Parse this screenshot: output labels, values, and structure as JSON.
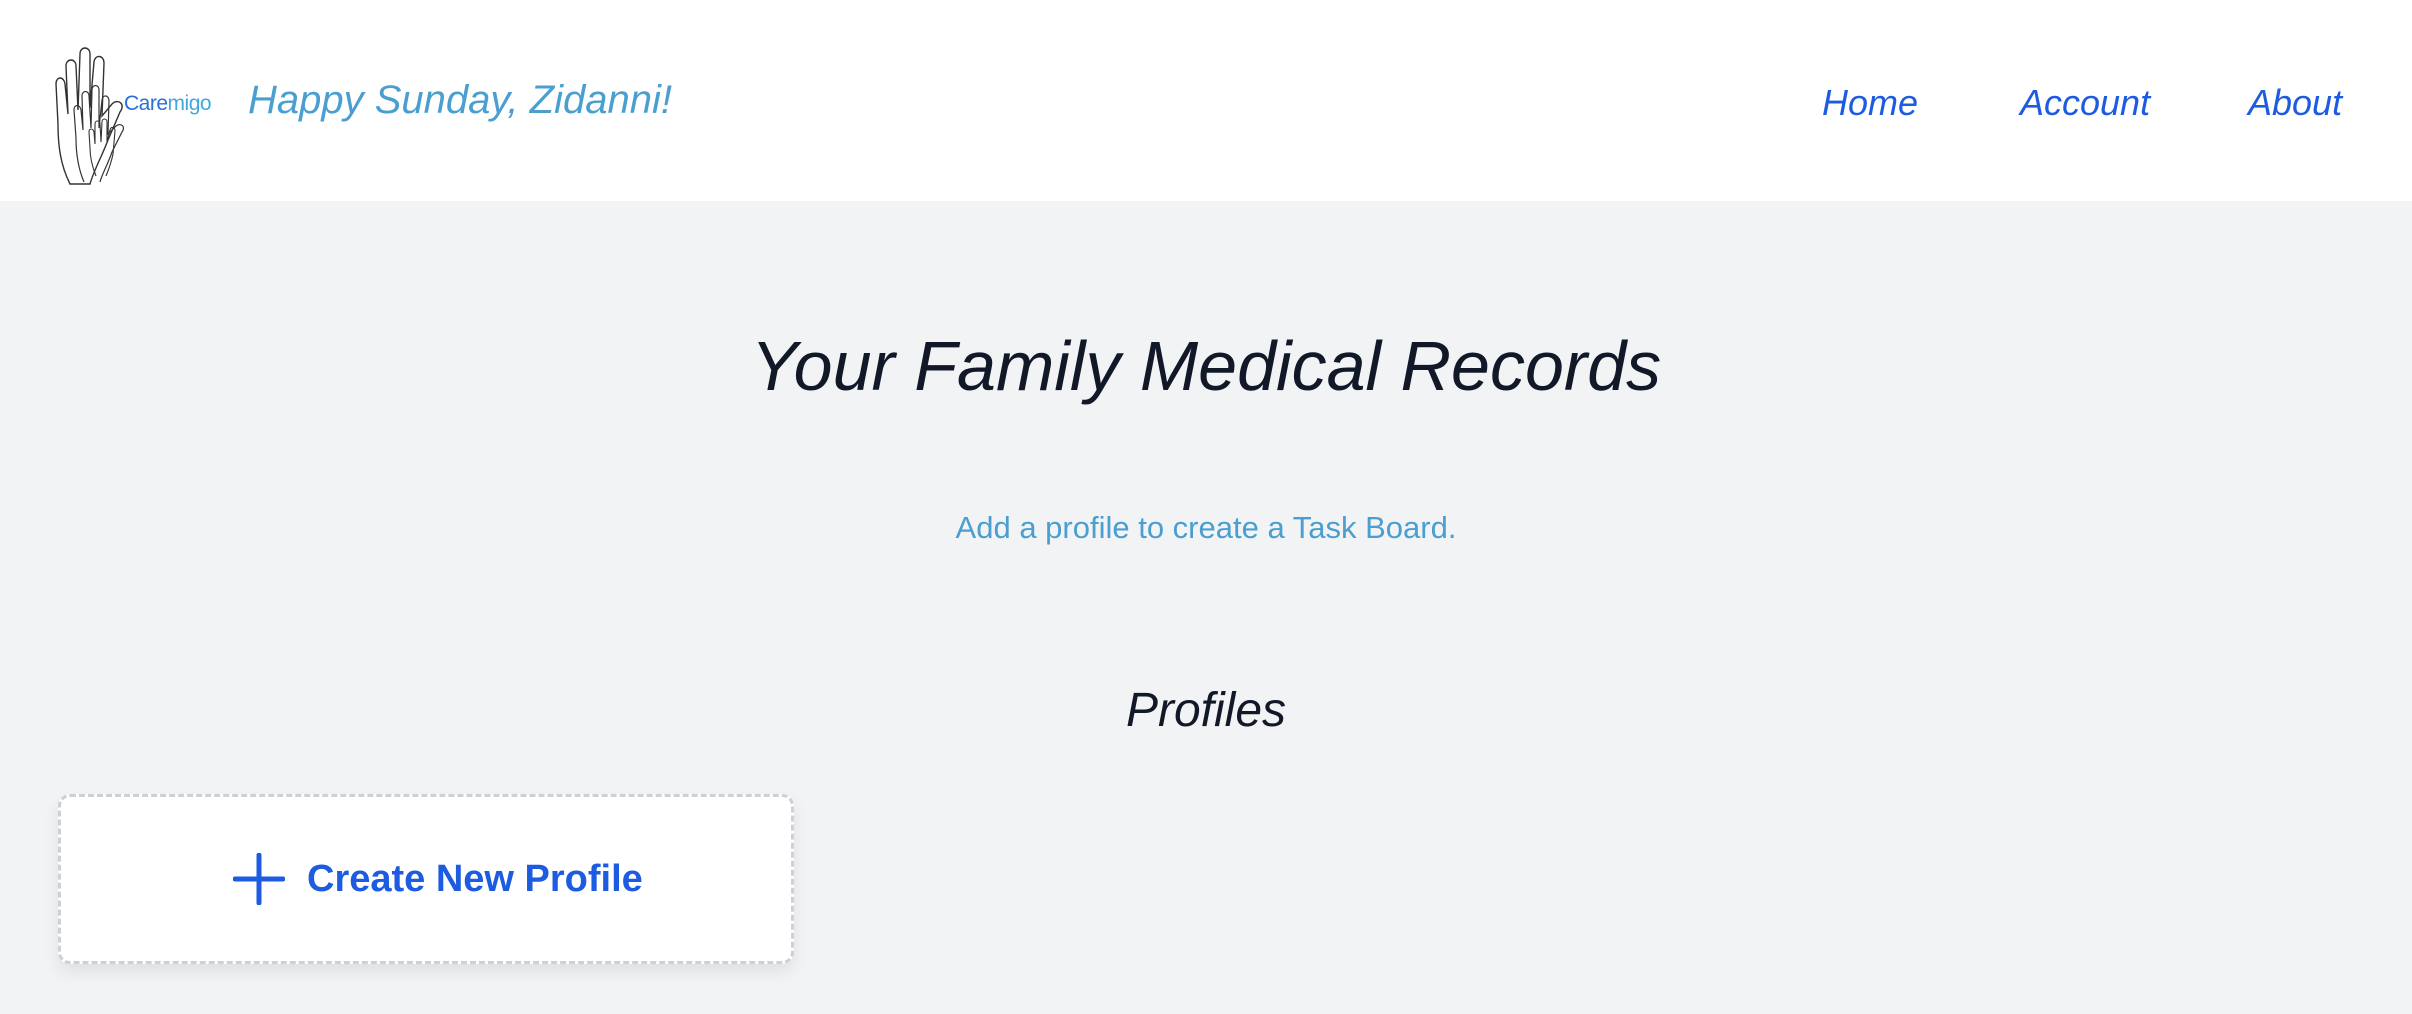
{
  "header": {
    "logo": {
      "text_part1": "Care",
      "text_part2": "migo",
      "icon": "hands-logo-icon"
    },
    "greeting": "Happy Sunday, Zidanni!",
    "nav": [
      {
        "label": "Home"
      },
      {
        "label": "Account"
      },
      {
        "label": "About"
      }
    ]
  },
  "main": {
    "title": "Your Family Medical Records",
    "subtitle": "Add a profile to create a Task Board.",
    "profiles_heading": "Profiles",
    "create_profile_label": "Create New Profile",
    "create_profile_icon": "plus-icon"
  },
  "colors": {
    "accent_blue": "#1d5be0",
    "light_blue": "#4a9fd0",
    "background": "#f2f3f5",
    "text_dark": "#111827"
  }
}
